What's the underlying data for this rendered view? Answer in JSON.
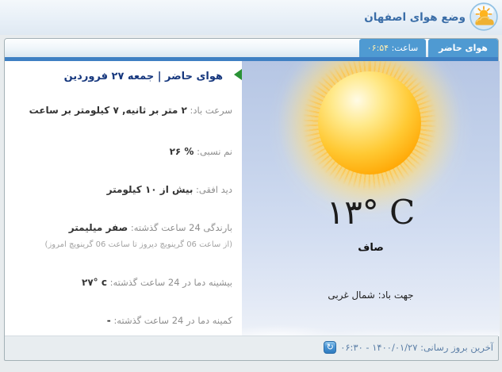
{
  "header": {
    "title": "وضع هوای اصفهان"
  },
  "tabs": {
    "current": "هوای حاضر",
    "clock_label": "ساعت:",
    "clock_time": "۰۶:۵۴"
  },
  "panel": {
    "header": "هوای حاضر | جمعه ۲۷ فروردین"
  },
  "details": {
    "rows": [
      {
        "label": "سرعت باد:",
        "value": "۲ متر بر ثانیه, ۷ کیلومتر بر ساعت"
      },
      {
        "label": "نم نسبی:",
        "value": "۲۶ %"
      },
      {
        "label": "دید افقی:",
        "value": "بیش از ۱۰ کیلومتر"
      },
      {
        "label": "بارندگی 24 ساعت گذشته:",
        "value": "صفر میلیمتر",
        "note": "(از ساعت 06 گرینویچ دیروز تا ساعت 06 گرینویچ امروز)"
      },
      {
        "label": "بیشینه دما در 24 ساعت گذشته:",
        "value": "۲۷° c"
      },
      {
        "label": "کمینه دما در 24 ساعت گذشته:",
        "value": "-"
      }
    ]
  },
  "current": {
    "temperature": "۱۳° C",
    "condition": "صاف",
    "wind_direction": "جهت باد: شمال غربی"
  },
  "footer": {
    "last_update": "آخرین بروز رسانی: ۱۴۰۰/۰۱/۲۷ - ۰۶:۳۰",
    "refresh_glyph": "↻"
  },
  "icons": {
    "header_icon": "sun-cloud-icon",
    "arrow": "green-arrow-icon",
    "refresh": "refresh-icon"
  },
  "colors": {
    "tab_blue": "#4f9ad2",
    "underline_blue": "#3f80c3",
    "header_navy": "#17387e",
    "title_blue": "#3a6da7",
    "arrow_green": "#2a9235",
    "sky_top": "#b6c6e4",
    "sun_orange": "#ffa400",
    "clock_digits": "#ffeeb0",
    "footer_text": "#5b7ea6"
  }
}
